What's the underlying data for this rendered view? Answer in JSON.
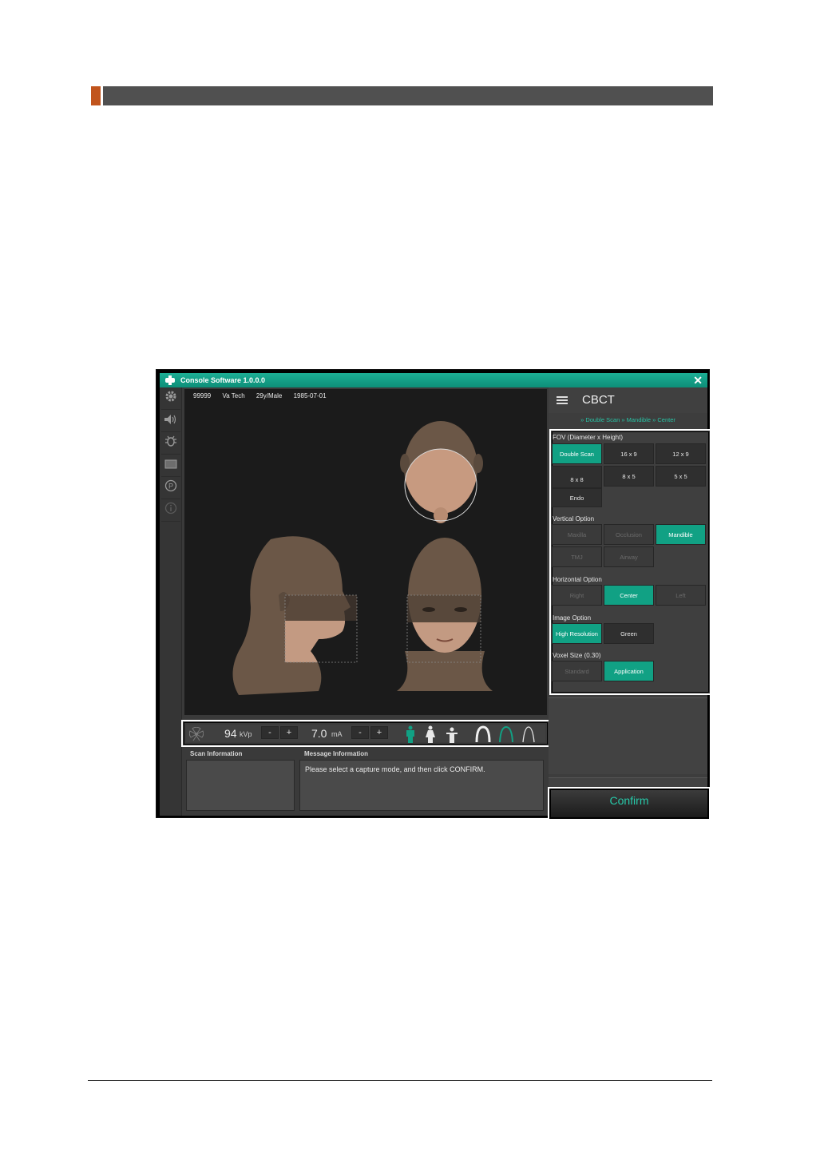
{
  "window": {
    "title": "Console Software  1.0.0.0",
    "close_glyph": "✕",
    "app_icon": "scanner-icon"
  },
  "sidebar": {
    "icons": [
      "gear-icon",
      "speaker-icon",
      "bug-icon",
      "monitor-icon",
      "parking-icon",
      "info-icon"
    ]
  },
  "patient": {
    "id": "99999",
    "name": "Va Tech",
    "age_sex": "29y/Male",
    "dob": "1985-07-01"
  },
  "exposure": {
    "kvp_value": "94",
    "kvp_unit": "kVp",
    "ma_value": "7.0",
    "ma_unit": "mA",
    "minus": "-",
    "plus": "+",
    "patient_sizes": [
      "adult-large-icon",
      "adult-female-icon",
      "child-icon"
    ],
    "arch_types": [
      "arch-wide-icon",
      "arch-medium-icon",
      "arch-narrow-icon"
    ]
  },
  "info": {
    "scan_header": "Scan Information",
    "message_header": "Message Information",
    "message_text": "Please select a capture mode, and then click CONFIRM."
  },
  "panel": {
    "mode_title": "CBCT",
    "breadcrumb": "» Double Scan » Mandible » Center",
    "fov_label": "FOV (Diameter x Height)",
    "fov_options": [
      "Double Scan",
      "16 x 9",
      "12 x 9",
      "8 x 8",
      "8 x 5",
      "5 x 5",
      "Endo"
    ],
    "vertical_label": "Vertical Option",
    "vertical_options": [
      "Maxilla",
      "Occlusion",
      "Mandible",
      "TMJ",
      "Airway"
    ],
    "horizontal_label": "Horizontal Option",
    "horizontal_options": [
      "Right",
      "Center",
      "Left"
    ],
    "image_label": "Image Option",
    "image_options": [
      "High Resolution",
      "Green"
    ],
    "voxel_label": "Voxel Size (0.30)",
    "voxel_options": [
      "Standard",
      "Application"
    ],
    "confirm_label": "Confirm"
  },
  "colors": {
    "accent": "#11a184",
    "title_bar": "#1cae95",
    "header_accent": "#c1541c"
  }
}
